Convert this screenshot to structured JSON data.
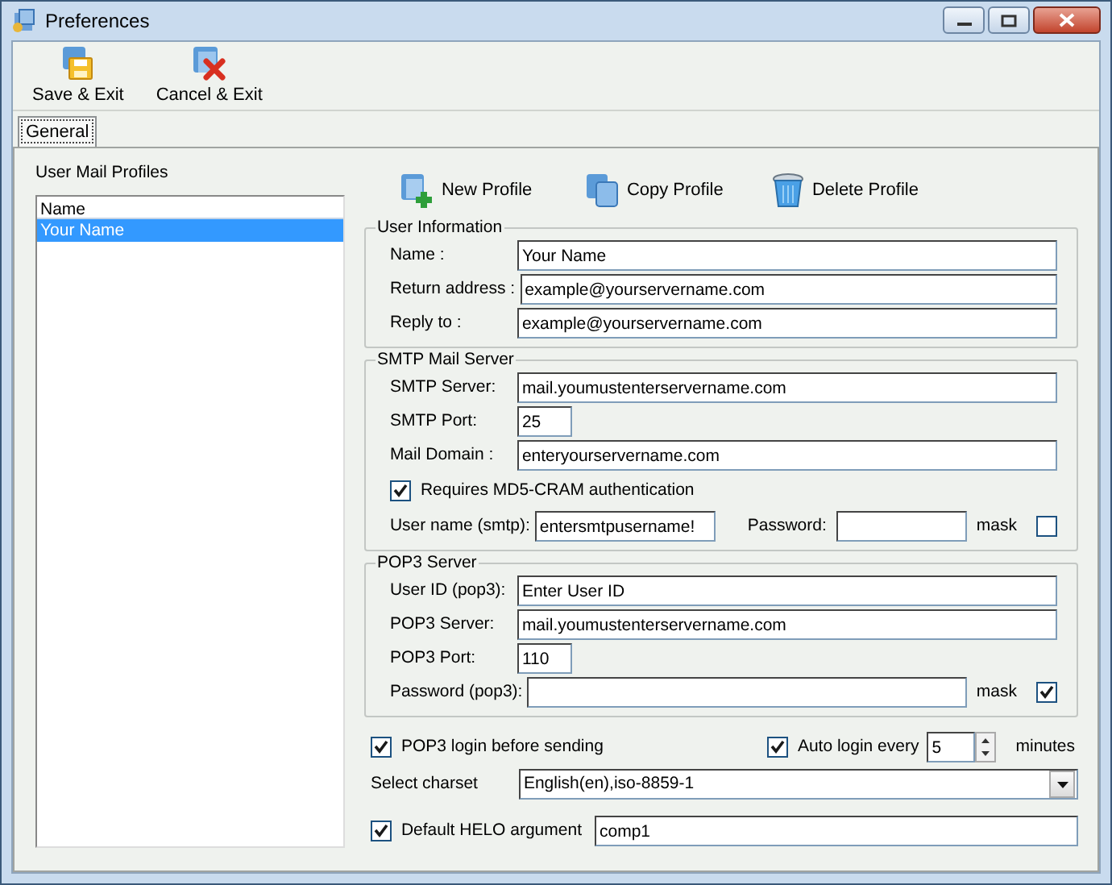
{
  "window": {
    "title": "Preferences"
  },
  "toolbar": [
    {
      "label": "Save & Exit",
      "kind": "save"
    },
    {
      "label": "Cancel & Exit",
      "kind": "cancel"
    }
  ],
  "tabs": [
    {
      "label": "General",
      "selected": true
    }
  ],
  "profiles": {
    "title": "User Mail Profiles",
    "column": "Name",
    "rows": [
      {
        "name": "Your Name",
        "selected": true
      }
    ]
  },
  "profile_actions": [
    {
      "label": "New Profile",
      "kind": "new"
    },
    {
      "label": "Copy Profile",
      "kind": "copy"
    },
    {
      "label": "Delete Profile",
      "kind": "delete"
    }
  ],
  "groups": [
    {
      "title": "User Information",
      "rows": [
        {
          "kind": "field",
          "label": "Name :",
          "value": "Your Name"
        },
        {
          "kind": "field",
          "label": "Return address :",
          "value": "example@yourservername.com"
        },
        {
          "kind": "field",
          "label": "Reply to :",
          "value": "example@yourservername.com"
        }
      ]
    },
    {
      "title": "SMTP Mail Server",
      "rows": [
        {
          "kind": "field",
          "label": "SMTP Server:",
          "value": "mail.youmustenterservername.com"
        },
        {
          "kind": "port",
          "label": "SMTP Port:",
          "value": "25"
        },
        {
          "kind": "field",
          "label": "Mail Domain :",
          "value": "enteryourservername.com"
        },
        {
          "kind": "checkbox",
          "label": "Requires MD5-CRAM authentication",
          "checked": true
        },
        {
          "kind": "login",
          "label": "User name (smtp):",
          "value": "entersmtpusername!",
          "password_label": "Password:",
          "mask_label": "mask",
          "mask_checked": false
        }
      ]
    },
    {
      "title": "POP3 Server",
      "rows": [
        {
          "kind": "field",
          "label": "User ID (pop3):",
          "value": "Enter User ID"
        },
        {
          "kind": "field",
          "label": "POP3 Server:",
          "value": "mail.youmustenterservername.com"
        },
        {
          "kind": "port",
          "label": "POP3 Port:",
          "value": "110"
        },
        {
          "kind": "password",
          "label": "Password (pop3):",
          "mask_label": "mask",
          "mask_checked": true
        }
      ]
    }
  ],
  "pop3_login": {
    "label": "POP3 login before sending",
    "checked": true
  },
  "auto_login": {
    "label": "Auto login every",
    "checked": true,
    "value": "5",
    "unit": "minutes"
  },
  "charset": {
    "label": "Select charset",
    "value": "English(en),iso-8859-1"
  },
  "helo": {
    "label": "Default HELO argument",
    "checked": true,
    "value": "comp1"
  }
}
